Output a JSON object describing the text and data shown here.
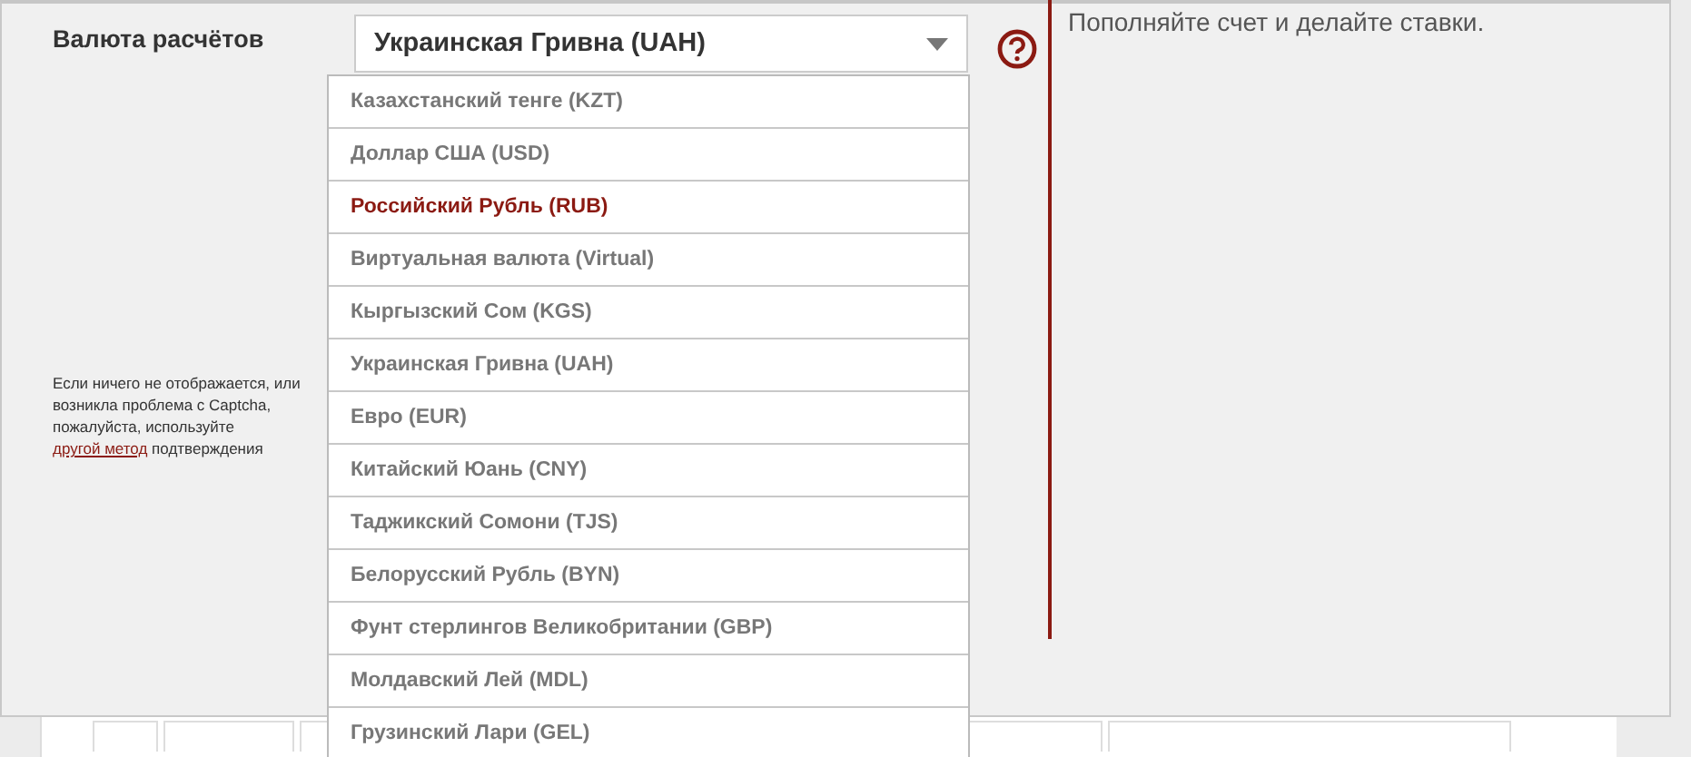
{
  "currency_field": {
    "label": "Валюта расчётов",
    "value": "Украинская Гривна (UAH)",
    "expanded": true
  },
  "options": [
    {
      "label": "Казахстанский тенге (KZT)",
      "highlighted": false
    },
    {
      "label": "Доллар США (USD)",
      "highlighted": false
    },
    {
      "label": "Российский Рубль (RUB)",
      "highlighted": true
    },
    {
      "label": "Виртуальная валюта (Virtual)",
      "highlighted": false
    },
    {
      "label": "Кыргызский Сом (KGS)",
      "highlighted": false
    },
    {
      "label": "Украинская Гривна (UAH)",
      "highlighted": false
    },
    {
      "label": "Евро (EUR)",
      "highlighted": false
    },
    {
      "label": "Китайский Юань (CNY)",
      "highlighted": false
    },
    {
      "label": "Таджикский Сомони (TJS)",
      "highlighted": false
    },
    {
      "label": "Белорусский Рубль (BYN)",
      "highlighted": false
    },
    {
      "label": "Фунт стерлингов Великобритании (GBP)",
      "highlighted": false
    },
    {
      "label": "Молдавский Лей (MDL)",
      "highlighted": false
    },
    {
      "label": "Грузинский Лари (GEL)",
      "highlighted": false
    }
  ],
  "captcha_note": {
    "before": "Если ничего не отображается, или возникла проблема с Captcha, пожалуйста, используйте ",
    "link": "другой метод",
    "after": " подтверждения"
  },
  "info_text": "Пополняйте счет и делайте ставки."
}
